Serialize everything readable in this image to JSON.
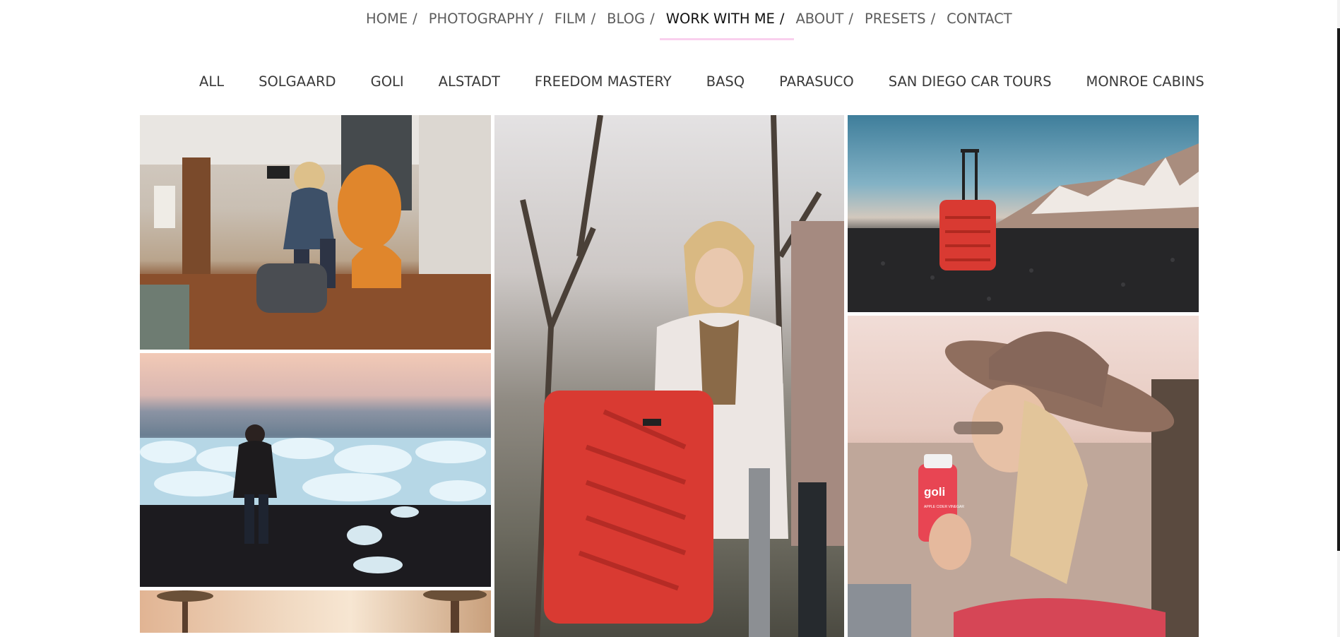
{
  "nav": {
    "items": [
      {
        "label": "HOME",
        "sep": "/"
      },
      {
        "label": "PHOTOGRAPHY",
        "sep": "/"
      },
      {
        "label": "FILM",
        "sep": "/"
      },
      {
        "label": "BLOG",
        "sep": "/"
      },
      {
        "label": "WORK WITH ME",
        "sep": "/"
      },
      {
        "label": "ABOUT",
        "sep": "/"
      },
      {
        "label": "PRESETS",
        "sep": "/"
      },
      {
        "label": "CONTACT",
        "sep": ""
      }
    ],
    "active_index": 4,
    "accent_color": "#f9d0ee"
  },
  "filters": [
    "ALL",
    "SOLGAARD",
    "GOLI",
    "ALSTADT",
    "FREEDOM MASTERY",
    "BASQ",
    "PARASUCO",
    "SAN DIEGO CAR TOURS",
    "MONROE CABINS"
  ],
  "photos": {
    "goli_bottle_label": "goli",
    "goli_bottle_sublabel": "APPLE CIDER VINEGAR"
  },
  "colors": {
    "text": "#5d5d5d",
    "active_text": "#111111",
    "suitcase_red": "#d93a32"
  }
}
